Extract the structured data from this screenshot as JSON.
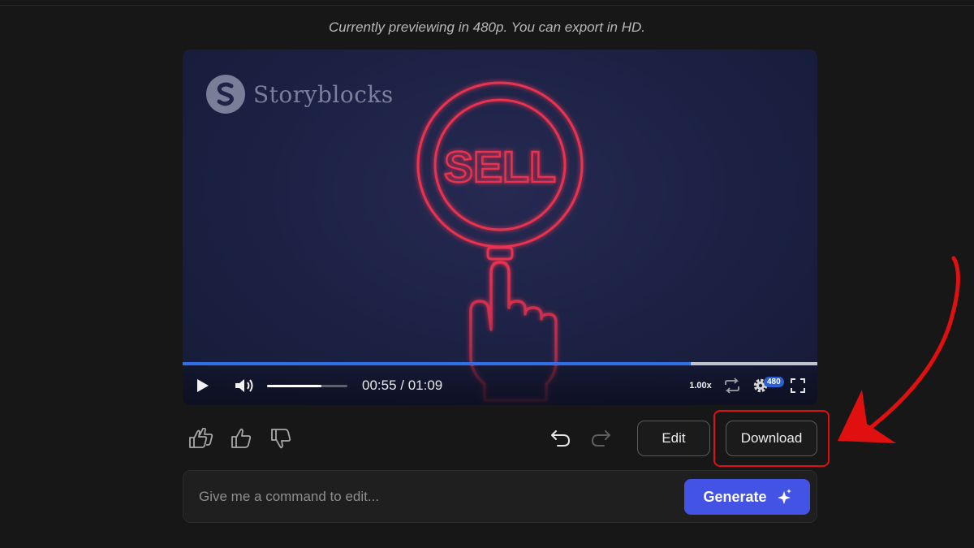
{
  "notice": {
    "text": "Currently previewing in 480p. You can export in HD."
  },
  "player": {
    "watermark": {
      "text": "Storyblocks"
    },
    "video_text": "SELL",
    "progress": {
      "played_fraction": 0.8,
      "buffered_fraction": 1.0
    },
    "volume": {
      "level_fraction": 0.68
    },
    "time": {
      "current": "00:55",
      "duration": "01:09",
      "display": "00:55 / 01:09"
    },
    "speed": "1.00x",
    "quality": "480",
    "icons": [
      "play-icon",
      "volume-icon",
      "loop-icon",
      "settings-icon",
      "fullscreen-icon"
    ]
  },
  "feedback": {
    "icons": [
      "love-icon",
      "thumbs-up-icon",
      "thumbs-down-icon",
      "undo-icon",
      "redo-icon"
    ],
    "edit_label": "Edit",
    "download_label": "Download"
  },
  "command": {
    "placeholder": "Give me a command to edit...",
    "value": "",
    "generate_label": "Generate"
  },
  "colors": {
    "accent": "#4353e6",
    "progress": "#2f6fe8",
    "annotation": "#e01010",
    "neon": "#e8324f"
  }
}
